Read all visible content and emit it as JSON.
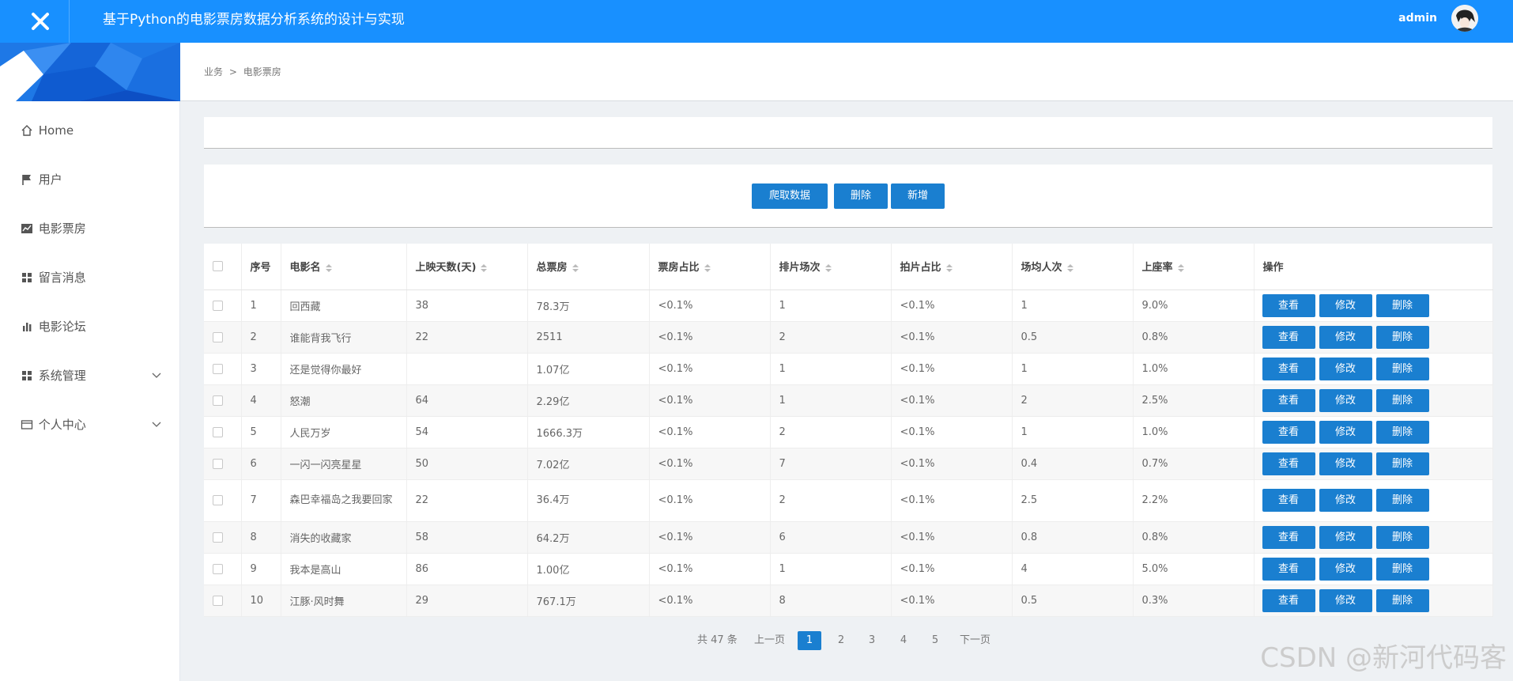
{
  "header": {
    "title": "基于Python的电影票房数据分析系统的设计与实现",
    "username": "admin",
    "colors": {
      "primary": "#1890ff",
      "button": "#1a7fd0"
    }
  },
  "sidebar": {
    "items": [
      {
        "label": "Home",
        "icon": "home-icon"
      },
      {
        "label": "用户",
        "icon": "flag-icon"
      },
      {
        "label": "电影票房",
        "icon": "chart-icon"
      },
      {
        "label": "留言消息",
        "icon": "grid-icon"
      },
      {
        "label": "电影论坛",
        "icon": "bar-chart-icon"
      },
      {
        "label": "系统管理",
        "icon": "grid-icon"
      },
      {
        "label": "个人中心",
        "icon": "card-icon"
      }
    ]
  },
  "breadcrumb": {
    "first": "业务",
    "separator": ">",
    "current": "电影票房"
  },
  "toolbar": {
    "crawl_label": "爬取数据",
    "delete_label": "删除",
    "add_label": "新增"
  },
  "table": {
    "headers": [
      "序号",
      "电影名",
      "上映天数(天)",
      "总票房",
      "票房占比",
      "排片场次",
      "拍片占比",
      "场均人次",
      "上座率",
      "操作"
    ],
    "actions": {
      "view": "查看",
      "edit": "修改",
      "delete": "删除"
    },
    "rows": [
      [
        "1",
        "回西藏",
        "38",
        "78.3万",
        "<0.1%",
        "1",
        "<0.1%",
        "1",
        "9.0%"
      ],
      [
        "2",
        "谁能背我飞行",
        "22",
        "2511",
        "<0.1%",
        "2",
        "<0.1%",
        "0.5",
        "0.8%"
      ],
      [
        "3",
        "还是觉得你最好",
        "",
        "1.07亿",
        "<0.1%",
        "1",
        "<0.1%",
        "1",
        "1.0%"
      ],
      [
        "4",
        "怒潮",
        "64",
        "2.29亿",
        "<0.1%",
        "1",
        "<0.1%",
        "2",
        "2.5%"
      ],
      [
        "5",
        "人民万岁",
        "54",
        "1666.3万",
        "<0.1%",
        "2",
        "<0.1%",
        "1",
        "1.0%"
      ],
      [
        "6",
        "一闪一闪亮星星",
        "50",
        "7.02亿",
        "<0.1%",
        "7",
        "<0.1%",
        "0.4",
        "0.7%"
      ],
      [
        "7",
        "森巴幸福岛之我要回家",
        "22",
        "36.4万",
        "<0.1%",
        "2",
        "<0.1%",
        "2.5",
        "2.2%"
      ],
      [
        "8",
        "消失的收藏家",
        "58",
        "64.2万",
        "<0.1%",
        "6",
        "<0.1%",
        "0.8",
        "0.8%"
      ],
      [
        "9",
        "我本是高山",
        "86",
        "1.00亿",
        "<0.1%",
        "1",
        "<0.1%",
        "4",
        "5.0%"
      ],
      [
        "10",
        "江豚·风时舞",
        "29",
        "767.1万",
        "<0.1%",
        "8",
        "<0.1%",
        "0.5",
        "0.3%"
      ]
    ]
  },
  "pagination": {
    "total": "共 47 条",
    "prev": "上一页",
    "pages": [
      "1",
      "2",
      "3",
      "4",
      "5"
    ],
    "current": "1",
    "next": "下一页"
  },
  "watermark": "CSDN @新河代码客"
}
